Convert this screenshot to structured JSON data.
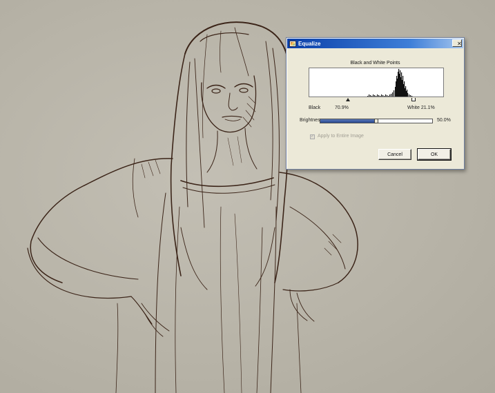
{
  "dialog": {
    "title": "Equalize",
    "close_glyph": "✕",
    "histogram_title": "Black and White Points",
    "black_label": "Black",
    "black_value": "70.9%",
    "white_label": "White 21.1%",
    "brightness_label": "Brightness",
    "brightness_value": "50.0%",
    "brightness_level": 0.5,
    "apply_label": "Apply to Entire Image",
    "apply_checked": true,
    "cancel_label": "Cancel",
    "ok_label": "OK"
  },
  "icons": {
    "title_icon": "equalize-app-icon",
    "close_icon": "close-icon"
  },
  "colors": {
    "titlebar_start": "#0a3fa8",
    "dialog_bg": "#ece9d8",
    "canvas": "#b9b5a9",
    "sketch_ink": "#3b2418"
  }
}
